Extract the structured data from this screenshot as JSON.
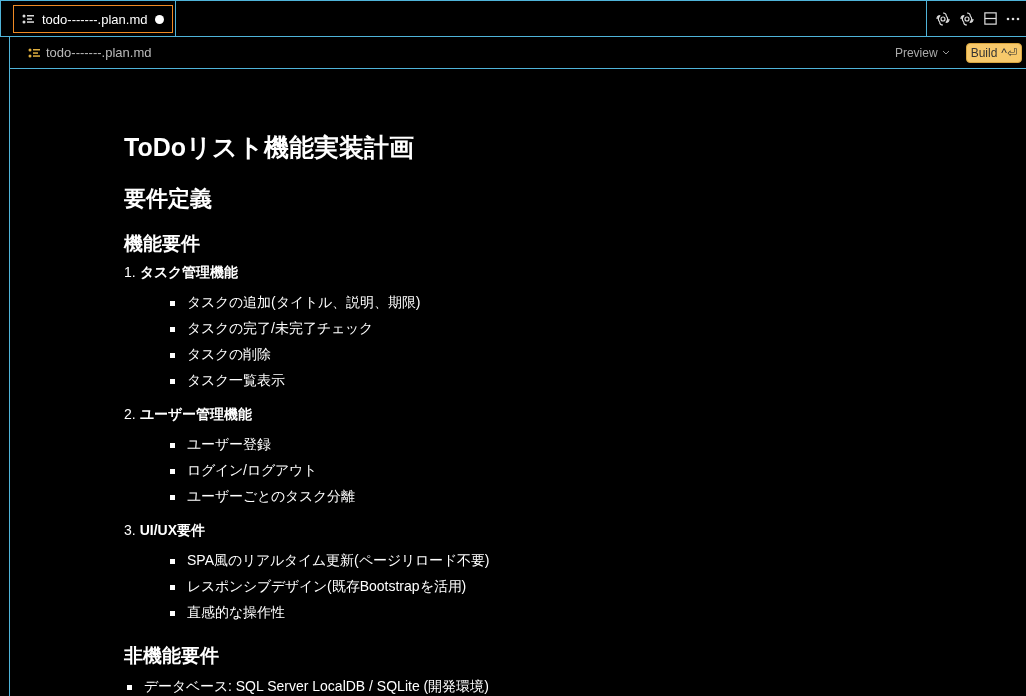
{
  "tabs": [
    {
      "label": "todo-------.plan.md",
      "selected": true,
      "modified": true
    }
  ],
  "breadcrumb": {
    "label": "todo-------.plan.md"
  },
  "preview_button": {
    "label": "Preview"
  },
  "build_button": {
    "label": "Build",
    "shortcut": "^⏎"
  },
  "document": [
    {
      "kind": "h1",
      "text": "ToDoリスト機能実装計画"
    },
    {
      "kind": "h2",
      "text": "要件定義"
    },
    {
      "kind": "h3",
      "text": "機能要件"
    },
    {
      "kind": "ol",
      "number": "1.",
      "text": "タスク管理機能",
      "children": [
        "タスクの追加(タイトル、説明、期限)",
        "タスクの完了/未完了チェック",
        "タスクの削除",
        "タスク一覧表示"
      ]
    },
    {
      "kind": "ol",
      "number": "2.",
      "text": "ユーザー管理機能",
      "children": [
        "ユーザー登録",
        "ログイン/ログアウト",
        "ユーザーごとのタスク分離"
      ]
    },
    {
      "kind": "ol",
      "number": "3.",
      "text": "UI/UX要件",
      "children": [
        "SPA風のリアルタイム更新(ページリロード不要)",
        "レスポンシブデザイン(既存Bootstrapを活用)",
        "直感的な操作性"
      ]
    },
    {
      "kind": "h3",
      "text": "非機能要件"
    },
    {
      "kind": "bullet",
      "text": "データベース: SQL Server LocalDB / SQLite (開発環境)"
    }
  ]
}
